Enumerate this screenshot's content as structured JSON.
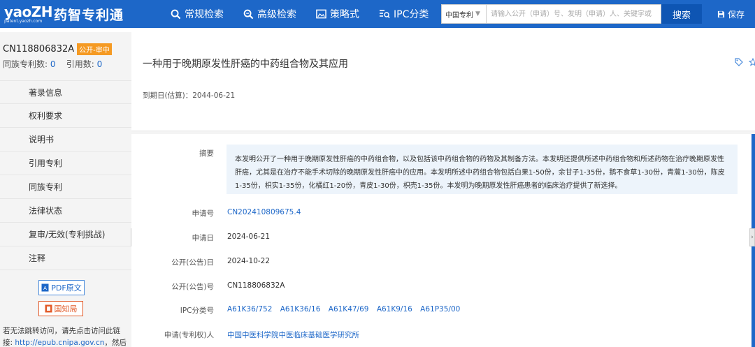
{
  "header": {
    "logo_en": "yaoZH",
    "logo_url": "patent.yaozh.com",
    "logo_cn": "药智专利通",
    "nav": [
      {
        "label": "常规检索",
        "icon": "search-icon"
      },
      {
        "label": "高级检索",
        "icon": "search-plus-icon"
      },
      {
        "label": "策略式",
        "icon": "image-icon"
      },
      {
        "label": "IPC分类",
        "icon": "list-search-icon"
      }
    ],
    "search_scope": "中国专利",
    "search_placeholder": "请输入公开（申请）号、发明（申请）人、关键字或",
    "search_button": "搜索",
    "save_label": "保存"
  },
  "sidebar": {
    "patent_number": "CN118806832A",
    "status_badge": "公开-审中",
    "family_label": "同族专利数:",
    "family_count": "0",
    "cite_label": "引用数:",
    "cite_count": "0",
    "menu": [
      "著录信息",
      "权利要求",
      "说明书",
      "引用专利",
      "同族专利",
      "法律状态",
      "复审/无效(专利挑战)",
      "注释"
    ],
    "pdf_label": "PDF原文",
    "cnipa_label": "国知局",
    "note_line1": "若无法跳转访问，请先点击访问此链",
    "note_line2_prefix": "接: ",
    "note_link": "http://epub.cnipa.gov.cn",
    "note_line2_suffix": "，然后再"
  },
  "main": {
    "title": "一种用于晚期原发性肝癌的中药组合物及其应用",
    "expiry": "到期日(估算)：2044-06-21",
    "abstract_label": "摘要",
    "abstract": "本发明公开了一种用于晚期原发性肝癌的中药组合物，以及包括该中药组合物的药物及其制备方法。本发明还提供所述中药组合物和所述药物在治疗晚期原发性肝癌，尤其是在治疗不能手术切除的晚期原发性肝癌中的应用。本发明所述中药组合物包括白果1-50份，余甘子1-35份，鹅不食草1-30份，青蒿1-30份，陈皮1-35份，枳实1-35份，化橘红1-20份，青皮1-30份，枳壳1-35份。本发明为晚期原发性肝癌患者的临床治疗提供了新选择。",
    "fields": {
      "app_no_label": "申请号",
      "app_no": "CN202410809675.4",
      "app_date_label": "申请日",
      "app_date": "2024-06-21",
      "pub_date_label": "公开(公告)日",
      "pub_date": "2024-10-22",
      "pub_no_label": "公开(公告)号",
      "pub_no": "CN118806832A",
      "ipc_label": "IPC分类号",
      "ipc": [
        "A61K36/752",
        "A61K36/16",
        "A61K47/69",
        "A61K9/16",
        "A61P35/00"
      ],
      "applicant_label": "申请(专利权)人",
      "applicant": "中国中医科学院中医临床基础医学研究所"
    }
  },
  "colors": {
    "brand": "#1d67c8",
    "badge": "#f59a23",
    "cnipa": "#e25b2a"
  }
}
